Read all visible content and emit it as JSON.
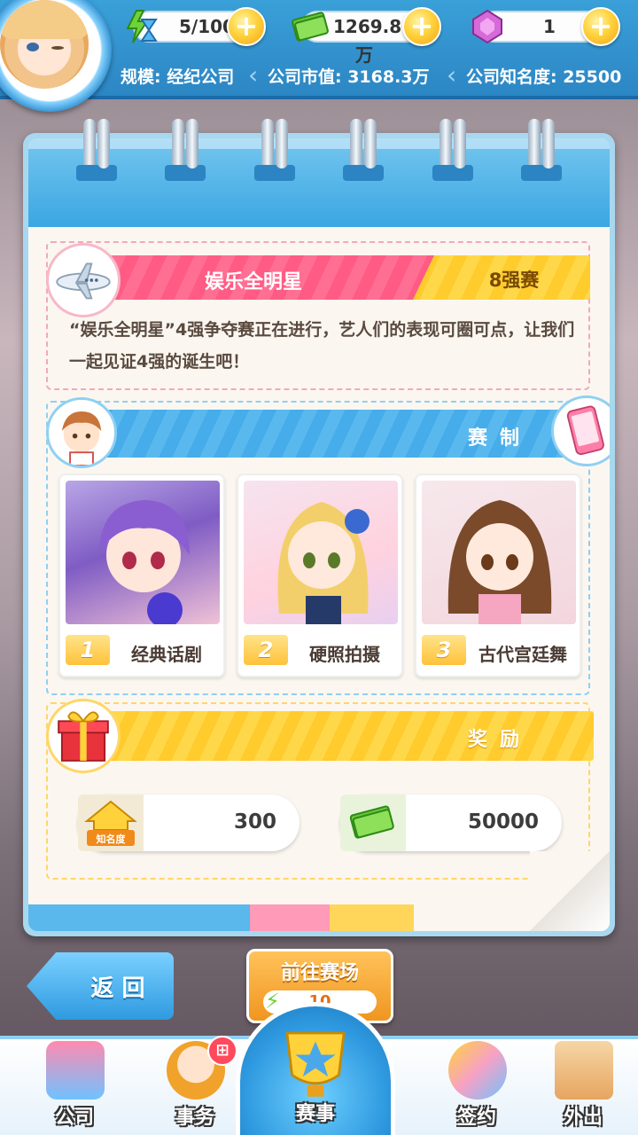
{
  "resources": {
    "energy": "5/100",
    "money": "1269.8万",
    "gems": "1"
  },
  "stats": {
    "scale": "规模: 经纪公司",
    "market_value": "公司市值: 3168.3万",
    "fame": "公司知名度: 25500"
  },
  "event": {
    "title": "娱乐全明星",
    "stage": "8强赛",
    "description": "“娱乐全明星”4强争夺赛正在进行，艺人们的表现可圈可点，让我们一起见证4强的诞生吧！"
  },
  "format": {
    "label": "赛制",
    "rounds": [
      {
        "round": "1",
        "name": "经典话剧"
      },
      {
        "round": "2",
        "name": "硬照拍摄"
      },
      {
        "round": "3",
        "name": "古代宫廷舞"
      }
    ]
  },
  "reward": {
    "label": "奖励",
    "fame_icon_label": "知名度",
    "fame_value": "300",
    "money_value": "50000"
  },
  "buttons": {
    "back": "返 回",
    "go": "前往赛场",
    "go_cost": "10"
  },
  "nav": {
    "items": [
      "公司",
      "事务",
      "赛事",
      "签约",
      "外出"
    ]
  },
  "colors": {
    "primary_blue": "#3aa6e2",
    "pink": "#ff6f93",
    "yellow": "#ffd84a",
    "orange": "#f09620"
  }
}
